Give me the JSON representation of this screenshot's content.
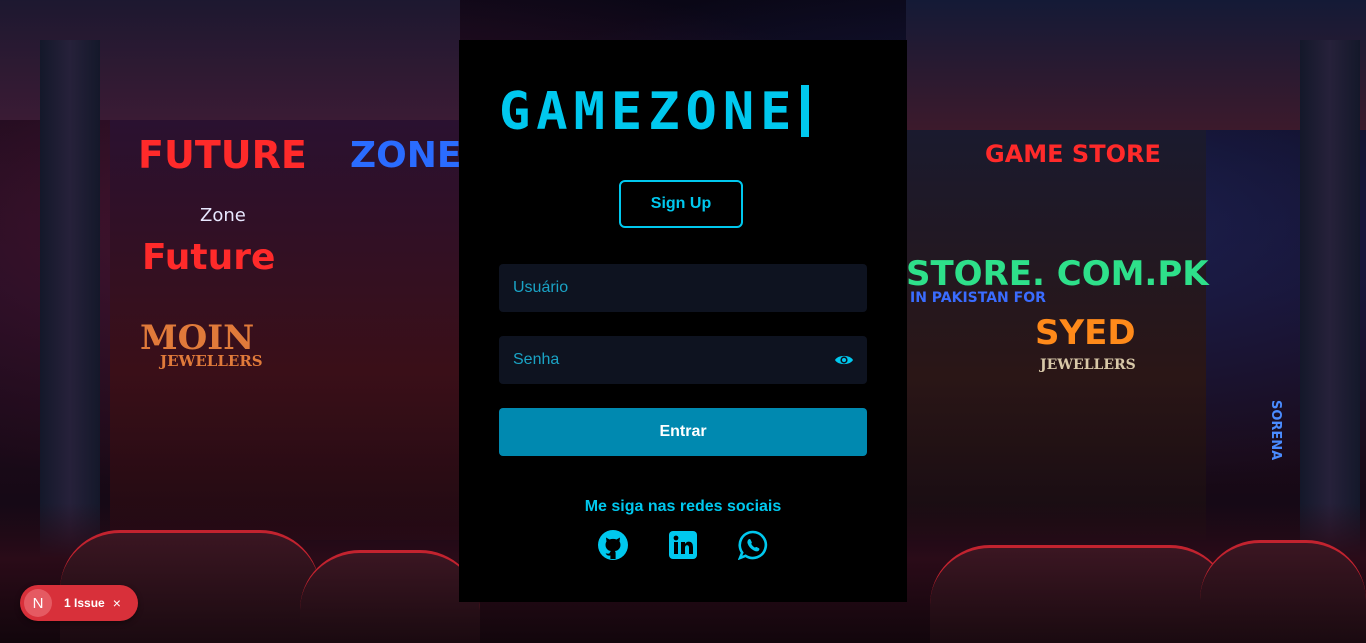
{
  "app": {
    "logo_text": "GAMEZONE",
    "signup_label": "Sign Up",
    "username_placeholder": "Usuário",
    "password_placeholder": "Senha",
    "submit_label": "Entrar",
    "social_label": "Me siga nas redes sociais",
    "accent_color": "#00c8ee",
    "button_color": "#0089b0",
    "card_color": "#000000",
    "field_color": "#0e1320",
    "icons": [
      "eye-icon",
      "github-icon",
      "linkedin-icon",
      "whatsapp-icon"
    ]
  },
  "background_signs": {
    "left_1": "FUTURE",
    "left_2": "ZONE",
    "left_3": "Zone",
    "left_4": "Future",
    "left_5": "MOIN",
    "left_6": "JEWELLERS",
    "right_1": "GAME STORE",
    "right_2": "STORE. COM.PK",
    "right_3": "IN PAKISTAN FOR",
    "right_4": "SYED",
    "right_5": "JEWELLERS",
    "right_6": "SORENA"
  },
  "issue_badge": {
    "avatar_letter": "N",
    "label": "1 Issue",
    "close_symbol": "×",
    "color": "#d8303a"
  }
}
